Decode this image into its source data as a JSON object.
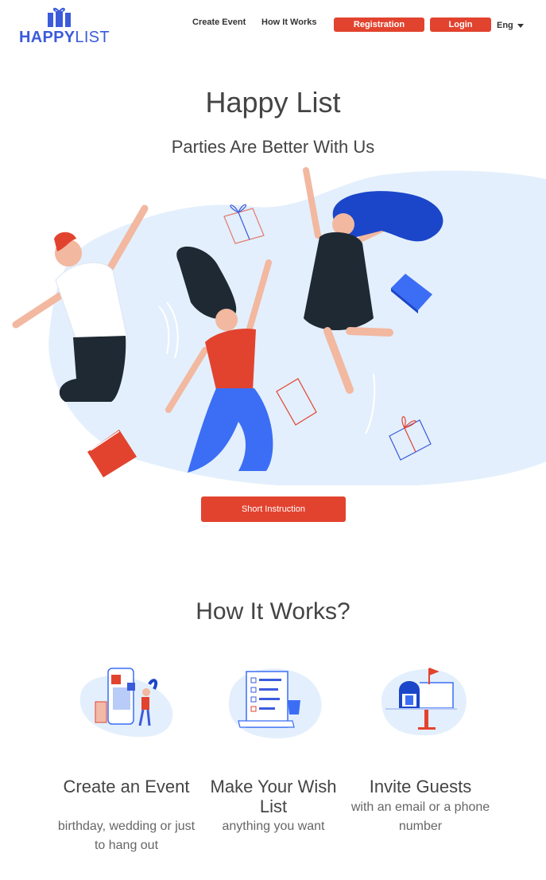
{
  "header": {
    "logo_bold": "HAPPY",
    "logo_light": "LIST",
    "nav": {
      "create_event": "Create Event",
      "how_it_works": "How It Works"
    },
    "registration": "Registration",
    "login": "Login",
    "language": "Eng"
  },
  "hero": {
    "title": "Happy List",
    "subtitle": "Parties Are Better With Us",
    "cta": "Short Instruction"
  },
  "how": {
    "title": "How It Works?",
    "steps": [
      {
        "title": "Create an Event",
        "desc": "birthday, wedding or just to hang out",
        "icon": "phone-event-icon"
      },
      {
        "title": "Make Your Wish List",
        "desc": "anything you want",
        "icon": "wishlist-icon"
      },
      {
        "title": "Invite Guests",
        "desc": "with an email or a phone number",
        "icon": "mailbox-icon"
      }
    ]
  },
  "colors": {
    "accent": "#e2432f",
    "brand": "#3b5bdb",
    "blob": "#e3effc"
  }
}
